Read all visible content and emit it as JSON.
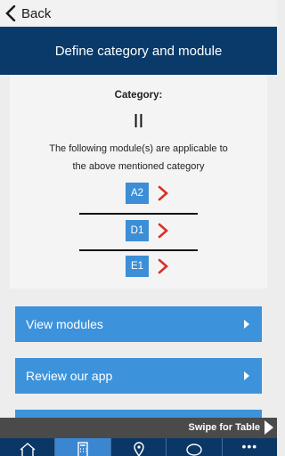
{
  "nav": {
    "back_label": "Back",
    "title": "Define category and module"
  },
  "category": {
    "label": "Category:",
    "value": "II",
    "description_line1": "The following module(s) are applicable to",
    "description_line2": "the above mentioned category"
  },
  "modules": [
    {
      "code": "A2",
      "icon": "chevron-right-icon"
    },
    {
      "code": "D1",
      "icon": "chevron-right-icon"
    },
    {
      "code": "E1",
      "icon": "chevron-right-icon"
    }
  ],
  "actions": [
    {
      "label": "View modules"
    },
    {
      "label": "Review our app"
    }
  ],
  "swipe_hint": "Swipe for Table",
  "tabbar": {
    "items": [
      {
        "icon": "home-icon",
        "active": false
      },
      {
        "icon": "calculator-icon",
        "active": true
      },
      {
        "icon": "location-pin-icon",
        "active": false
      },
      {
        "icon": "chat-bubble-icon",
        "active": false
      },
      {
        "icon": "more-dots-icon",
        "active": false
      }
    ]
  },
  "colors": {
    "header_bg": "#0a3a6a",
    "button_blue": "#3c93dc",
    "badge_blue": "#3c8fd6",
    "chevron_red": "#d9302a",
    "tab_active": "#3a86d0"
  }
}
